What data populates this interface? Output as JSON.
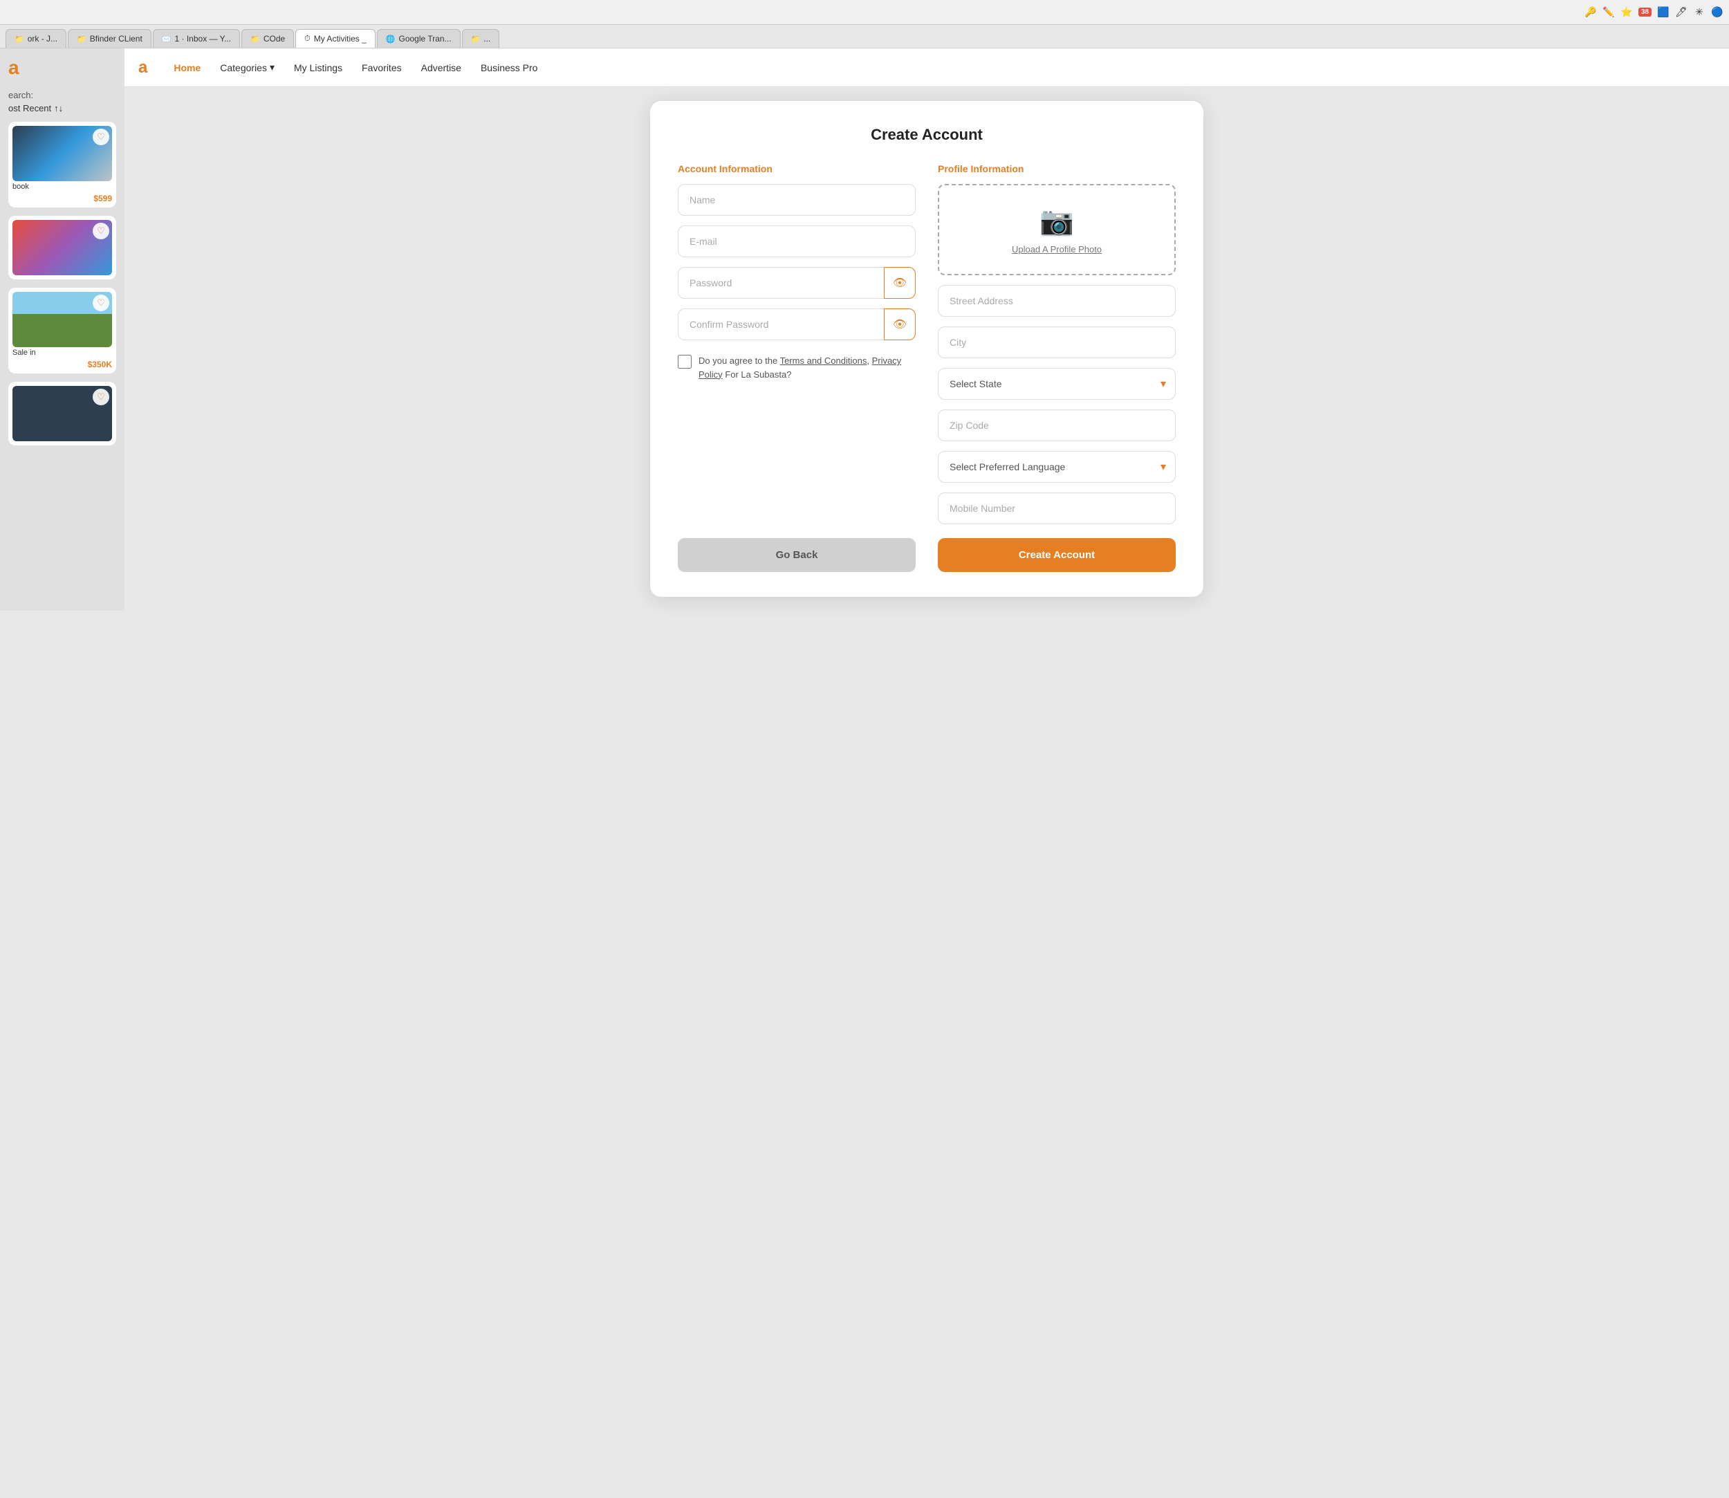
{
  "browser": {
    "toolbar_icons": [
      "key",
      "edit",
      "star"
    ],
    "badge_count": "38",
    "tabs": [
      {
        "id": "tab1",
        "label": "ork - J...",
        "icon": "📁",
        "active": false
      },
      {
        "id": "tab2",
        "label": "Bfinder CLient",
        "icon": "📁",
        "active": false
      },
      {
        "id": "tab3",
        "label": "1 · Inbox — Y...",
        "icon": "✉️",
        "active": false
      },
      {
        "id": "tab4",
        "label": "COde",
        "icon": "📁",
        "active": false
      },
      {
        "id": "tab5",
        "label": "My Activities...",
        "icon": "⏱",
        "active": false
      },
      {
        "id": "tab6",
        "label": "Google Tran...",
        "icon": "🌐",
        "active": false
      },
      {
        "id": "tab7",
        "label": "...",
        "icon": "📁",
        "active": false
      }
    ]
  },
  "nav": {
    "logo": "a",
    "items": [
      {
        "id": "home",
        "label": "Home",
        "active": true
      },
      {
        "id": "categories",
        "label": "Categories",
        "hasDropdown": true
      },
      {
        "id": "mylistings",
        "label": "My Listings"
      },
      {
        "id": "favorites",
        "label": "Favorites"
      },
      {
        "id": "advertise",
        "label": "Advertise"
      },
      {
        "id": "businesspro",
        "label": "Business Pro"
      }
    ]
  },
  "sidebar": {
    "logo": "a",
    "search_label": "earch:",
    "sort_label": "ost Recent",
    "cards": [
      {
        "id": "card1",
        "type": "laptop",
        "price": "$599",
        "label": "book"
      },
      {
        "id": "card2",
        "type": "colorful",
        "price": "",
        "label": ""
      },
      {
        "id": "card3",
        "type": "house",
        "price": "$350K",
        "label": "Sale in"
      },
      {
        "id": "card4",
        "type": "dark",
        "price": "",
        "label": ""
      }
    ]
  },
  "form": {
    "title": "Create Account",
    "account_section_title": "Account Information",
    "profile_section_title": "Profile Information",
    "fields": {
      "name_placeholder": "Name",
      "email_placeholder": "E-mail",
      "password_placeholder": "Password",
      "confirm_password_placeholder": "Confirm Password",
      "street_address_placeholder": "Street Address",
      "city_placeholder": "City",
      "zip_code_placeholder": "Zip Code",
      "mobile_placeholder": "Mobile Number"
    },
    "dropdowns": {
      "state_label": "Select State",
      "language_label": "Select Preferred Language"
    },
    "photo_upload_label": "Upload A Profile Photo",
    "terms_text": "Do you agree to the",
    "terms_link": "Terms and Conditions",
    "privacy_link": "Privacy Policy",
    "terms_suffix": "For La Subasta?",
    "buttons": {
      "go_back": "Go Back",
      "create_account": "Create Account"
    }
  }
}
